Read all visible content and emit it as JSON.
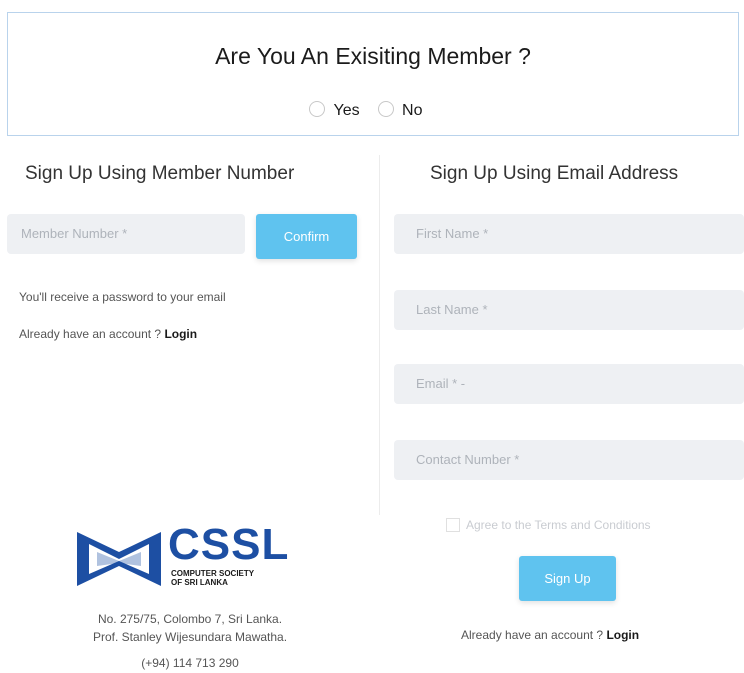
{
  "question": {
    "title": "Are You An Exisiting Member ?",
    "options": [
      "Yes",
      "No"
    ]
  },
  "member_section": {
    "title": "Sign Up Using Member Number",
    "member_placeholder": "Member Number *",
    "confirm_label": "Confirm",
    "info_text": "You'll receive a password to your email",
    "account_prompt": "Already have an account ? ",
    "login_label": "Login"
  },
  "email_section": {
    "title": "Sign Up Using Email Address",
    "first_name_placeholder": "First Name *",
    "last_name_placeholder": "Last Name *",
    "email_placeholder": "Email * -",
    "contact_placeholder": "Contact Number *",
    "terms_label": "Agree to the Terms and Conditions",
    "signup_label": "Sign Up",
    "account_prompt": "Already have an account ? ",
    "login_label": "Login"
  },
  "logo": {
    "text": "CSSL",
    "subtitle_line1": "COMPUTER SOCIETY",
    "subtitle_line2": "OF SRI LANKA",
    "brand_color": "#1d4fa3"
  },
  "address": {
    "line1": "No. 275/75, Colombo 7, Sri Lanka.",
    "line2": "Prof. Stanley Wijesundara Mawatha.",
    "phone": "(+94) 114 713 290"
  },
  "colors": {
    "accent": "#5fc3ef",
    "input_bg": "#eef0f3"
  }
}
